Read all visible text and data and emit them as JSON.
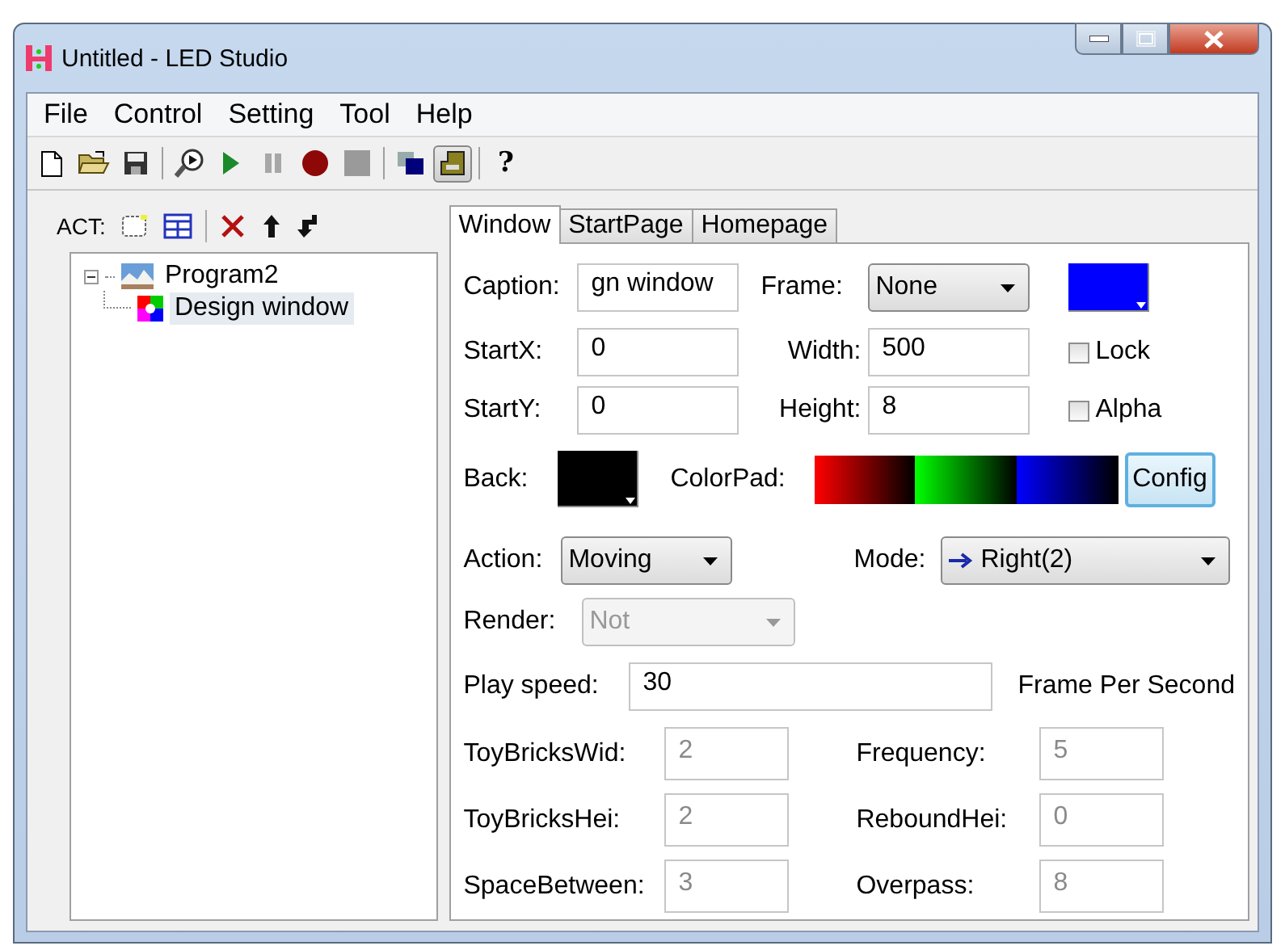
{
  "window": {
    "title": "Untitled - LED Studio"
  },
  "menu": [
    {
      "label": "File"
    },
    {
      "label": "Control"
    },
    {
      "label": "Setting"
    },
    {
      "label": "Tool"
    },
    {
      "label": "Help"
    }
  ],
  "toolbar": [
    [
      {
        "kind": "new",
        "disabled": false,
        "selected": false
      },
      {
        "kind": "open",
        "disabled": false,
        "selected": false
      },
      {
        "kind": "save",
        "disabled": false,
        "selected": false
      }
    ],
    [
      {
        "kind": "preview",
        "disabled": false,
        "selected": false
      },
      {
        "kind": "play",
        "disabled": false,
        "selected": false
      },
      {
        "kind": "pause",
        "disabled": true,
        "selected": false
      },
      {
        "kind": "record",
        "disabled": false,
        "selected": false
      },
      {
        "kind": "stop",
        "disabled": true,
        "selected": false
      }
    ],
    [
      {
        "kind": "layers",
        "disabled": false,
        "selected": false
      },
      {
        "kind": "window",
        "disabled": false,
        "selected": true
      }
    ],
    [
      {
        "text": "?",
        "disabled": false,
        "selected": false
      }
    ]
  ],
  "act": {
    "label": "ACT:",
    "tools": [
      [
        {
          "kind": "select-area"
        },
        {
          "kind": "layout"
        }
      ],
      [
        {
          "kind": "delete"
        },
        {
          "kind": "move-up"
        },
        {
          "kind": "back"
        }
      ]
    ]
  },
  "tree": [
    {
      "label": "Program2",
      "kind": "program",
      "expanded": true,
      "selected": false,
      "children": [
        {
          "label": "Design window",
          "kind": "window",
          "selected": true
        }
      ]
    }
  ],
  "tabs": [
    {
      "label": "Window",
      "selected": true
    },
    {
      "label": "StartPage",
      "selected": false
    },
    {
      "label": "Homepage",
      "selected": false
    }
  ],
  "form": {
    "caption": {
      "label": "Caption:",
      "value": "gn window"
    },
    "frame": {
      "label": "Frame:",
      "value": "None"
    },
    "frame_color": {
      "color": "#0000ff"
    },
    "start_x": {
      "label": "StartX:",
      "value": "0"
    },
    "width": {
      "label": "Width:",
      "value": "500"
    },
    "lock": {
      "label": "Lock",
      "checked": false
    },
    "start_y": {
      "label": "StartY:",
      "value": "0"
    },
    "height": {
      "label": "Height:",
      "value": "8"
    },
    "alpha": {
      "label": "Alpha",
      "checked": false
    },
    "back": {
      "label": "Back:",
      "color": "#000000"
    },
    "color_pad": {
      "label": "ColorPad:"
    },
    "config_button": {
      "label": "Config"
    },
    "action": {
      "label": "Action:",
      "value": "Moving"
    },
    "mode": {
      "label": "Mode:",
      "value": "Right(2)"
    },
    "render": {
      "label": "Render:",
      "value": "Not",
      "disabled": true
    },
    "play_speed": {
      "label": "Play speed:",
      "value": "30",
      "unit": "Frame Per Second"
    },
    "params": [
      {
        "label": "ToyBricksWid:",
        "value": "2",
        "disabled": true
      },
      {
        "label": "Frequency:",
        "value": "5",
        "disabled": true
      },
      {
        "label": "ToyBricksHei:",
        "value": "2",
        "disabled": true
      },
      {
        "label": "ReboundHei:",
        "value": "0",
        "disabled": true
      },
      {
        "label": "SpaceBetween:",
        "value": "3",
        "disabled": true
      },
      {
        "label": "Overpass:",
        "value": "8",
        "disabled": true
      }
    ]
  }
}
